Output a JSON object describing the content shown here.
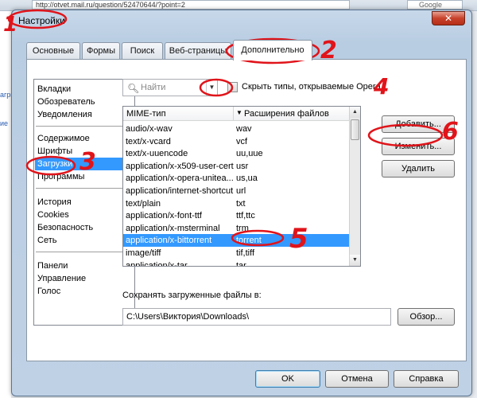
{
  "browser": {
    "url": "http://otvet.mail.ru/question/52470644/?point=2",
    "search_placeholder": "Google",
    "side_text_1": "агры",
    "side_text_2": "ие"
  },
  "window": {
    "title": "Настройки",
    "close_symbol": "✕"
  },
  "tabs": [
    {
      "label": "Основные"
    },
    {
      "label": "Формы"
    },
    {
      "label": "Поиск"
    },
    {
      "label": "Веб-страницы"
    },
    {
      "label": "Дополнительно",
      "active": true
    }
  ],
  "sidebar": {
    "items": [
      {
        "label": "Вкладки"
      },
      {
        "label": "Обозреватель"
      },
      {
        "label": "Уведомления"
      },
      {
        "label": "Содержимое"
      },
      {
        "label": "Шрифты"
      },
      {
        "label": "Загрузки",
        "selected": true
      },
      {
        "label": "Программы"
      },
      {
        "label": "История"
      },
      {
        "label": "Cookies"
      },
      {
        "label": "Безопасность"
      },
      {
        "label": "Сеть"
      },
      {
        "label": "Панели"
      },
      {
        "label": "Управление"
      },
      {
        "label": "Голос"
      }
    ]
  },
  "search": {
    "placeholder": "Найти",
    "icon": "search-icon"
  },
  "hide_types": {
    "label": "Скрыть типы, открываемые Opera",
    "checked": false
  },
  "mime_table": {
    "col_mime": "MIME-тип",
    "col_ext": "Расширения файлов",
    "rows": [
      {
        "mime": "audio/x-wav",
        "ext": "wav"
      },
      {
        "mime": "text/x-vcard",
        "ext": "vcf"
      },
      {
        "mime": "text/x-uuencode",
        "ext": "uu,uue"
      },
      {
        "mime": "application/x-x509-user-cert",
        "ext": "usr"
      },
      {
        "mime": "application/x-opera-unitea...",
        "ext": "us,ua"
      },
      {
        "mime": "application/internet-shortcut",
        "ext": "url"
      },
      {
        "mime": "text/plain",
        "ext": "txt"
      },
      {
        "mime": "application/x-font-ttf",
        "ext": "ttf,ttc"
      },
      {
        "mime": "application/x-msterminal",
        "ext": "trm"
      },
      {
        "mime": "application/x-bittorrent",
        "ext": "torrent",
        "selected": true
      },
      {
        "mime": "image/tiff",
        "ext": "tif,tiff"
      },
      {
        "mime": "application/x-tar",
        "ext": "tar"
      }
    ]
  },
  "buttons": {
    "add": "Добавить...",
    "edit": "Изменить...",
    "delete": "Удалить",
    "browse": "Обзор...",
    "ok": "OK",
    "cancel": "Отмена",
    "help": "Справка"
  },
  "downloads": {
    "save_label": "Сохранять загруженные файлы в:",
    "path": "C:\\Users\\Виктория\\Downloads\\"
  },
  "annotations": {
    "n1": "1",
    "n2": "2",
    "n3": "3",
    "n4": "4",
    "n5": "5",
    "n6": "6",
    "color": "#e0141a"
  },
  "colors": {
    "selection": "#3399ff",
    "close_button": "#c8412b"
  }
}
